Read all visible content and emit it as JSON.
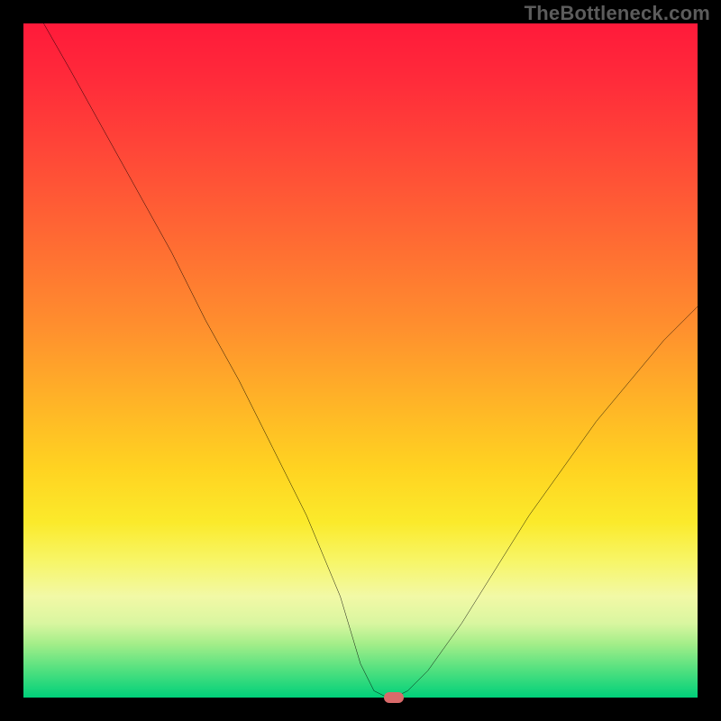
{
  "watermark": "TheBottleneck.com",
  "colors": {
    "frame": "#000000",
    "watermark": "#5c5c5c",
    "curve": "#000000",
    "marker": "#d96a6a",
    "gradient_stops": [
      "#ff1a3a",
      "#ff6a33",
      "#ffd321",
      "#f7f66a",
      "#00d07a"
    ]
  },
  "chart_data": {
    "type": "line",
    "title": "",
    "xlabel": "",
    "ylabel": "",
    "xlim": [
      0,
      100
    ],
    "ylim": [
      0,
      100
    ],
    "x": [
      3,
      7,
      12,
      17,
      22,
      27,
      32,
      37,
      42,
      47,
      50,
      52,
      54,
      55,
      57,
      60,
      65,
      70,
      75,
      80,
      85,
      90,
      95,
      100
    ],
    "y": [
      100,
      93,
      84,
      75,
      66,
      56,
      47,
      37,
      27,
      15,
      5,
      1,
      0,
      0,
      1,
      4,
      11,
      19,
      27,
      34,
      41,
      47,
      53,
      58
    ],
    "marker": {
      "x": 55,
      "y": 0
    },
    "grid": false,
    "legend": false
  }
}
